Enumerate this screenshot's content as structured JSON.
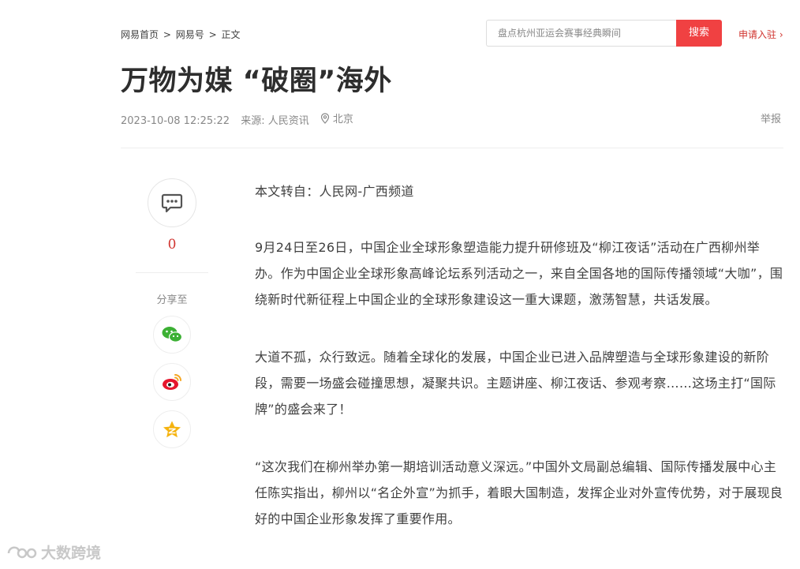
{
  "breadcrumb": {
    "items": [
      "网易首页",
      "网易号",
      "正文"
    ],
    "separator": ">"
  },
  "search": {
    "placeholder": "盘点杭州亚运会赛事经典瞬间",
    "button_label": "搜索"
  },
  "apply_link": "申请入驻 ›",
  "article": {
    "title": "万物为媒 “破圈”海外",
    "date": "2023-10-08 12:25:22",
    "source": "来源: 人民资讯",
    "location": "北京",
    "report_label": "举报",
    "paragraphs": [
      "本文转自：人民网-广西频道",
      "9月24日至26日，中国企业全球形象塑造能力提升研修班及“柳江夜话”活动在广西柳州举办。作为中国企业全球形象高峰论坛系列活动之一，来自全国各地的国际传播领域“大咖”，围绕新时代新征程上中国企业的全球形象建设这一重大课题，激荡智慧，共话发展。",
      "大道不孤，众行致远。随着全球化的发展，中国企业已进入品牌塑造与全球形象建设的新阶段，需要一场盛会碰撞思想，凝聚共识。主题讲座、柳江夜话、参观考察……这场主打“国际牌”的盛会来了！",
      "“这次我们在柳州举办第一期培训活动意义深远。”中国外文局副总编辑、国际传播发展中心主任陈实指出，柳州以“名企外宣”为抓手，着眼大国制造，发挥企业对外宣传优势，对于展现良好的中国企业形象发挥了重要作用。"
    ]
  },
  "sidebar": {
    "comment_count": "0",
    "share_label": "分享至",
    "share_icons": [
      "wechat-icon",
      "weibo-icon",
      "qzone-icon"
    ]
  },
  "watermark": "大数跨境",
  "colors": {
    "accent": "#f04142",
    "link_red": "#d0332e",
    "meta_gray": "#888888",
    "wechat_green": "#3cb034",
    "weibo_red": "#e6162d",
    "qzone_yellow": "#f5b30f"
  }
}
